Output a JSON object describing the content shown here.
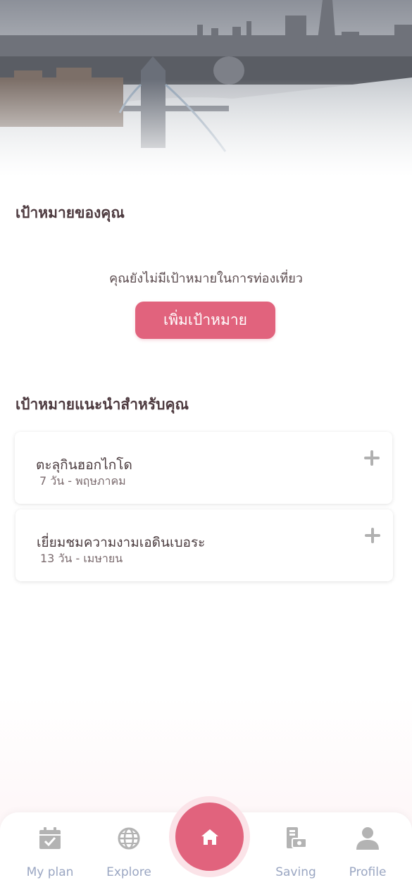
{
  "goals": {
    "title": "เป้าหมายของคุณ",
    "empty_message": "คุณยังไม่มีเป้าหมายในการท่องเที่ยว",
    "add_button": "เพิ่มเป้าหมาย"
  },
  "recommended": {
    "title": "เป้าหมายแนะนำสำหรับคุณ",
    "items": [
      {
        "title": "ตะลุกินฮอกไกโด",
        "subtitle": "7 วัน - พฤษภาคม"
      },
      {
        "title": "เยี่ยมชมความงามเอดินเบอระ",
        "subtitle": "13 วัน - เมษายน"
      }
    ]
  },
  "tabbar": {
    "myplan": "My plan",
    "explore": "Explore",
    "saving": "Saving",
    "profile": "Profile",
    "icons": [
      "calendar-check-icon",
      "globe-icon",
      "home-icon",
      "printer-money-icon",
      "user-icon"
    ]
  },
  "colors": {
    "accent": "#e1637d",
    "tab_inactive": "#9aa6c2",
    "icon_gray": "#b3b3b3"
  }
}
